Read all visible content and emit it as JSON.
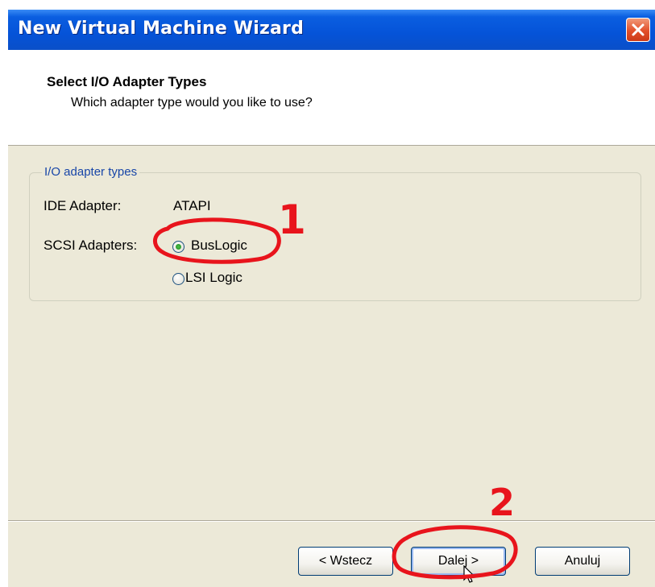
{
  "window": {
    "title": "New Virtual Machine Wizard",
    "close_icon": "close-x-icon"
  },
  "header": {
    "title": "Select I/O Adapter Types",
    "subtitle": "Which adapter type would you like to use?"
  },
  "group": {
    "legend": "I/O adapter types",
    "ide_label": "IDE Adapter:",
    "ide_value": "ATAPI",
    "scsi_label": "SCSI Adapters:",
    "options": [
      {
        "label": "BusLogic",
        "selected": true
      },
      {
        "label": "LSI Logic",
        "selected": false
      }
    ]
  },
  "buttons": {
    "back": "< Wstecz",
    "next": "Dalej >",
    "cancel": "Anuluj"
  },
  "annotations": {
    "mark_1": "1",
    "mark_2": "2",
    "color": "#e8141c"
  }
}
